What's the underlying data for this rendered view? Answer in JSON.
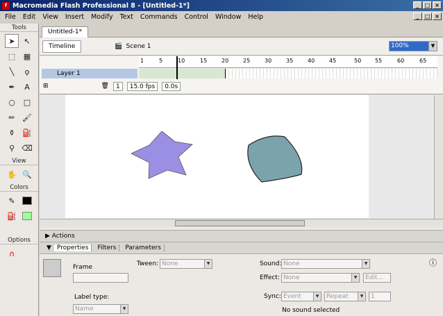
{
  "window": {
    "title": "Macromedia Flash Professional 8 - [Untitled-1*]",
    "btn_min": "_",
    "btn_max": "□",
    "btn_close": "×"
  },
  "menu": [
    "File",
    "Edit",
    "View",
    "Insert",
    "Modify",
    "Text",
    "Commands",
    "Control",
    "Window",
    "Help"
  ],
  "tools": {
    "title": "Tools",
    "view_title": "View",
    "colors_title": "Colors",
    "options_title": "Options"
  },
  "document": {
    "tab": "Untitled-1*",
    "timeline_button": "Timeline",
    "scene": "Scene 1",
    "zoom": "100%"
  },
  "timeline": {
    "layer_name": "Layer 1",
    "ruler": [
      "1",
      "5",
      "10",
      "15",
      "20",
      "25",
      "30",
      "35",
      "40",
      "45",
      "50",
      "55",
      "60",
      "65"
    ],
    "current_frame": "1",
    "fps": "15.0 fps",
    "time": "0.0s"
  },
  "colors": {
    "star": "#9b8fe3",
    "blob": "#7ba3ab",
    "stage": "#ffffff"
  },
  "panels": {
    "actions": "Actions",
    "tabs": [
      "Properties",
      "Filters",
      "Parameters"
    ]
  },
  "props": {
    "frame_label": "Frame",
    "tween_label": "Tween:",
    "tween_value": "None",
    "label_type_label": "Label type:",
    "label_type_value": "Name",
    "sound_label": "Sound:",
    "sound_value": "None",
    "effect_label": "Effect:",
    "effect_value": "None",
    "edit_button": "Edit...",
    "sync_label": "Sync:",
    "sync_value": "Event",
    "repeat_value": "Repeat",
    "repeat_count": "1",
    "status": "No sound selected"
  }
}
